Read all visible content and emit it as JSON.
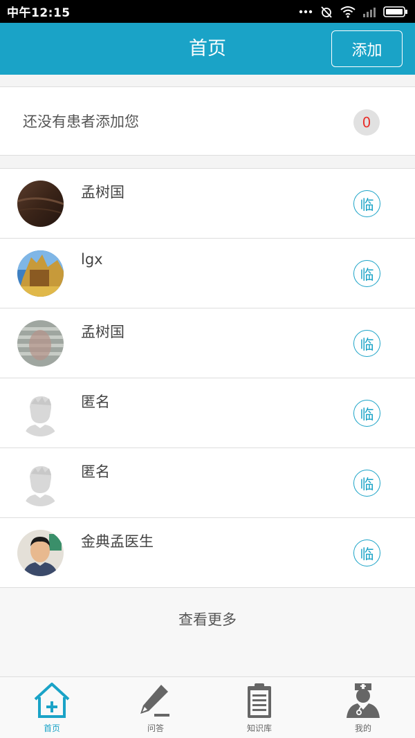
{
  "status_bar": {
    "time": "中午12:15"
  },
  "header": {
    "title": "首页",
    "add_label": "添加"
  },
  "notice": {
    "text": "还没有患者添加您",
    "count": "0"
  },
  "patients": [
    {
      "name": "孟树国",
      "avatar": "photo-dark",
      "action_label": "临"
    },
    {
      "name": "lgx",
      "avatar": "photo-landscape",
      "action_label": "临"
    },
    {
      "name": "孟树国",
      "avatar": "photo-blurred",
      "action_label": "临"
    },
    {
      "name": "匿名",
      "avatar": "default-avatar",
      "action_label": "临"
    },
    {
      "name": "匿名",
      "avatar": "default-avatar",
      "action_label": "临"
    },
    {
      "name": "金典孟医生",
      "avatar": "photo-person",
      "action_label": "临"
    }
  ],
  "more": {
    "label": "查看更多"
  },
  "tabs": [
    {
      "label": "首页",
      "icon": "home-plus-icon",
      "active": true
    },
    {
      "label": "问答",
      "icon": "pencil-icon",
      "active": false
    },
    {
      "label": "知识库",
      "icon": "clipboard-icon",
      "active": false
    },
    {
      "label": "我的",
      "icon": "doctor-icon",
      "active": false
    }
  ],
  "colors": {
    "accent": "#1aa3c7",
    "badge_text": "#e8302c"
  }
}
